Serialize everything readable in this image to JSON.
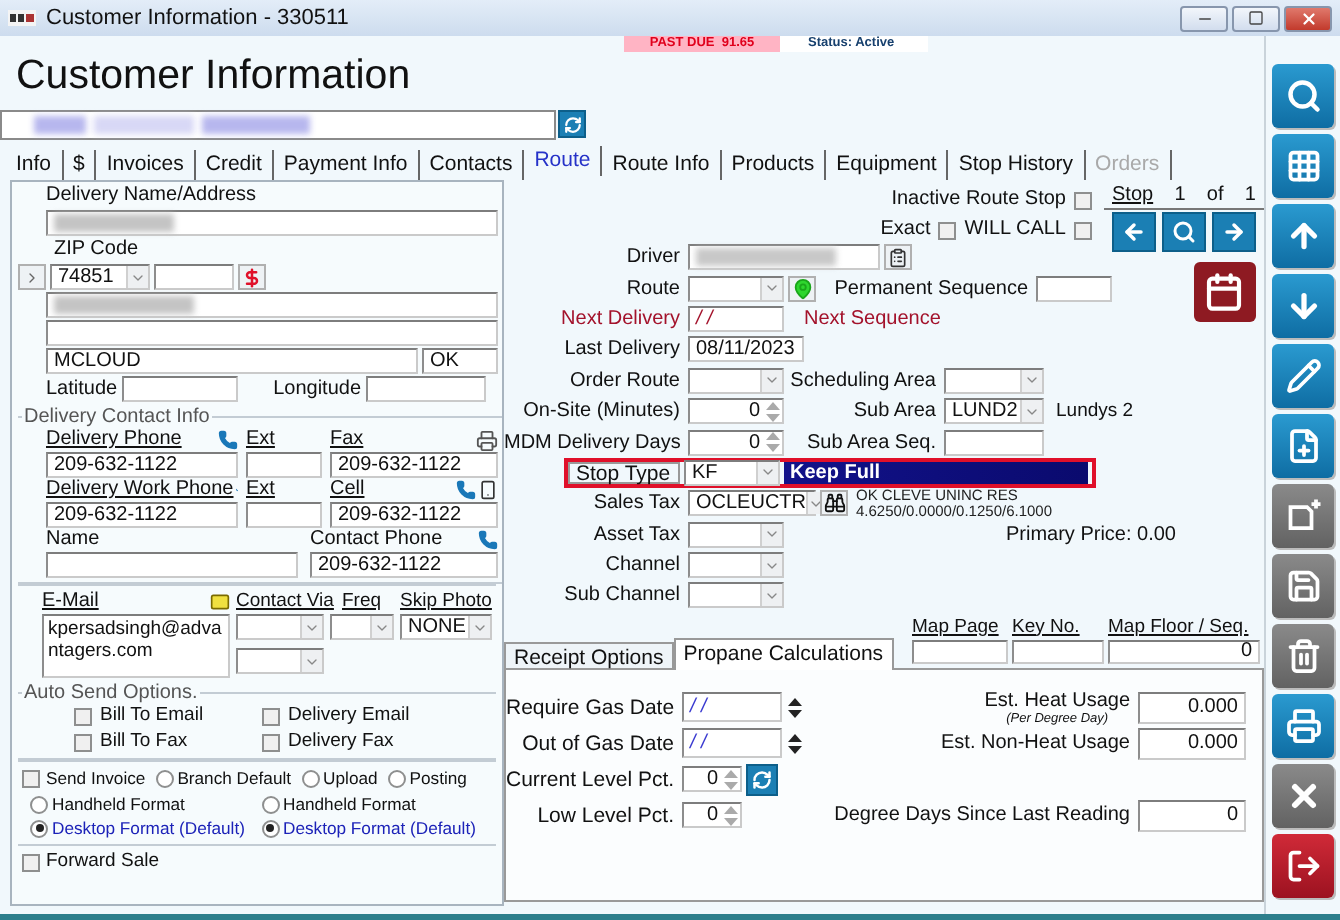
{
  "window": {
    "title": "Customer Information - 330511"
  },
  "header": {
    "title": "Customer Information",
    "past_due": "PAST DUE  91.65",
    "status": "Status: Active"
  },
  "tabs": [
    {
      "label": "Info",
      "selected": false,
      "disabled": false
    },
    {
      "label": "$",
      "selected": false,
      "disabled": false
    },
    {
      "label": "Invoices",
      "selected": false,
      "disabled": false
    },
    {
      "label": "Credit",
      "selected": false,
      "disabled": false
    },
    {
      "label": "Payment Info",
      "selected": false,
      "disabled": false
    },
    {
      "label": "Contacts",
      "selected": false,
      "disabled": false
    },
    {
      "label": "Route",
      "selected": true,
      "disabled": false
    },
    {
      "label": "Route Info",
      "selected": false,
      "disabled": false
    },
    {
      "label": "Products",
      "selected": false,
      "disabled": false
    },
    {
      "label": "Equipment",
      "selected": false,
      "disabled": false
    },
    {
      "label": "Stop History",
      "selected": false,
      "disabled": false
    },
    {
      "label": "Orders",
      "selected": false,
      "disabled": true
    }
  ],
  "address": {
    "name_label": "Delivery Name/Address",
    "zip_label": "ZIP Code",
    "zip": "74851",
    "city": "MCLOUD",
    "state": "OK",
    "latitude_label": "Latitude",
    "longitude_label": "Longitude"
  },
  "contact": {
    "legend": "Delivery Contact Info",
    "phones": [
      {
        "label": "Delivery Phone",
        "value": "209-632-1122",
        "ext_label": "Ext",
        "other_label": "Fax",
        "other_value": "209-632-1122",
        "kind": "fax"
      },
      {
        "label": "Delivery Work Phone",
        "value": "209-632-1122",
        "ext_label": "Ext",
        "other_label": "Cell",
        "other_value": "209-632-1122",
        "kind": "cell"
      }
    ],
    "name_label": "Name",
    "contact_phone_label": "Contact Phone",
    "contact_phone": "209-632-1122"
  },
  "email": {
    "label": "E-Mail",
    "value": "kpersadsingh@advantagers.com",
    "contact_via_label": "Contact Via",
    "freq_label": "Freq",
    "skip_photo_label": "Skip Photo",
    "skip_photo": "NONE"
  },
  "auto_send": {
    "legend": "Auto Send Options.",
    "options": [
      {
        "label": "Bill To Email",
        "checked": false
      },
      {
        "label": "Delivery Email",
        "checked": false
      },
      {
        "label": "Bill To Fax",
        "checked": false
      },
      {
        "label": "Delivery Fax",
        "checked": false
      }
    ]
  },
  "invoice": {
    "send_invoice": {
      "label": "Send Invoice",
      "checked": false
    },
    "destinations": [
      {
        "label": "Branch Default",
        "selected": false
      },
      {
        "label": "Upload",
        "selected": false
      },
      {
        "label": "Posting",
        "selected": false
      }
    ],
    "format_groups": [
      {
        "options": [
          {
            "label": "Handheld Format",
            "selected": false
          },
          {
            "label": "Desktop Format (Default)",
            "selected": true
          }
        ]
      },
      {
        "options": [
          {
            "label": "Handheld Format",
            "selected": false
          },
          {
            "label": "Desktop Format (Default)",
            "selected": true
          }
        ]
      }
    ]
  },
  "forward_sale": {
    "label": "Forward Sale",
    "checked": false
  },
  "route_flags": [
    {
      "label": "Inactive Route Stop",
      "checked": false
    },
    {
      "label": "Exact",
      "checked": false
    },
    {
      "label": "WILL CALL",
      "checked": false
    }
  ],
  "stop_nav": {
    "label": "Stop",
    "current": "1",
    "of": "of",
    "total": "1"
  },
  "route_fields": [
    {
      "label": "Driver",
      "kind": "redacted",
      "button": {
        "kind": "clipboard"
      },
      "alert": false,
      "highlighted": false
    },
    {
      "label": "Route",
      "kind": "combo",
      "button": {
        "kind": "pin"
      },
      "alert": false,
      "highlighted": false,
      "side": {
        "kind": "field",
        "label": "Permanent Sequence",
        "alert": false
      }
    },
    {
      "label": "Next Delivery",
      "kind": "date",
      "value": "/ /",
      "alert": true,
      "highlighted": false,
      "side": {
        "kind": "label",
        "label": "Next Sequence",
        "alert": true
      }
    },
    {
      "label": "Last Delivery",
      "kind": "text",
      "value": "08/11/2023",
      "alert": false,
      "highlighted": false
    },
    {
      "label": "Order Route",
      "kind": "combo",
      "alert": false,
      "highlighted": false,
      "side": {
        "kind": "combo",
        "label": "Scheduling Area",
        "alert": false
      }
    },
    {
      "label": "On-Site (Minutes)",
      "kind": "spinner",
      "value": "0",
      "alert": false,
      "highlighted": false,
      "side": {
        "kind": "combo",
        "label": "Sub Area",
        "value": "LUND2",
        "note": "Lundys 2",
        "alert": false
      }
    },
    {
      "label": "MDM Delivery Days",
      "kind": "spinner",
      "value": "0",
      "alert": false,
      "highlighted": false,
      "side": {
        "kind": "text",
        "label": "Sub Area Seq.",
        "alert": false
      }
    },
    {
      "label": "Stop Type",
      "kind": "combo",
      "value": "KF",
      "description": "Keep Full",
      "alert": false,
      "highlighted": true
    },
    {
      "label": "Sales Tax",
      "kind": "combo",
      "value": "OCLEUCTR",
      "button": {
        "kind": "binoculars"
      },
      "details": [
        "OK CLEVE UNINC RES",
        "4.6250/0.0000/0.1250/6.1000"
      ],
      "alert": false,
      "highlighted": false
    },
    {
      "label": "Asset Tax",
      "kind": "combo",
      "alert": false,
      "highlighted": false,
      "side": {
        "kind": "note",
        "label": "Primary Price: 0.00",
        "alert": false
      }
    },
    {
      "label": "Channel",
      "kind": "combo",
      "alert": false,
      "highlighted": false
    },
    {
      "label": "Sub Channel",
      "kind": "combo",
      "alert": false,
      "highlighted": false
    }
  ],
  "map": {
    "columns": [
      {
        "label": "Map Page"
      },
      {
        "label": "Key No."
      },
      {
        "label": "Map Floor / Seq.",
        "value": "0"
      }
    ]
  },
  "subtabs": [
    {
      "label": "Receipt Options",
      "selected": false
    },
    {
      "label": "Propane Calculations",
      "selected": true
    }
  ],
  "propane": {
    "left": [
      {
        "label": "Require Gas Date",
        "kind": "date",
        "value": "/ /"
      },
      {
        "label": "Out of Gas Date",
        "kind": "date",
        "value": "/ /"
      },
      {
        "label": "Current Level Pct.",
        "kind": "spinner",
        "value": "0",
        "refresh": true
      },
      {
        "label": "Low Level Pct.",
        "kind": "spinner",
        "value": "0",
        "refresh": false
      }
    ],
    "right": [
      {
        "label": "Est. Heat Usage",
        "sublabel": "(Per Degree Day)",
        "value": "0.000"
      },
      {
        "label": "Est. Non-Heat Usage",
        "value": "0.000"
      },
      {
        "label": "Degree Days Since Last Reading",
        "value": "0"
      }
    ]
  },
  "toolbar": [
    {
      "kind": "search",
      "disabled": false
    },
    {
      "kind": "grid",
      "disabled": false
    },
    {
      "kind": "up",
      "disabled": false
    },
    {
      "kind": "down",
      "disabled": false
    },
    {
      "kind": "edit",
      "disabled": false
    },
    {
      "kind": "new",
      "disabled": false
    },
    {
      "kind": "save-new",
      "disabled": true
    },
    {
      "kind": "save",
      "disabled": true
    },
    {
      "kind": "delete",
      "disabled": true
    },
    {
      "kind": "print",
      "disabled": false
    },
    {
      "kind": "close",
      "disabled": true
    },
    {
      "kind": "exit",
      "disabled": false
    }
  ]
}
